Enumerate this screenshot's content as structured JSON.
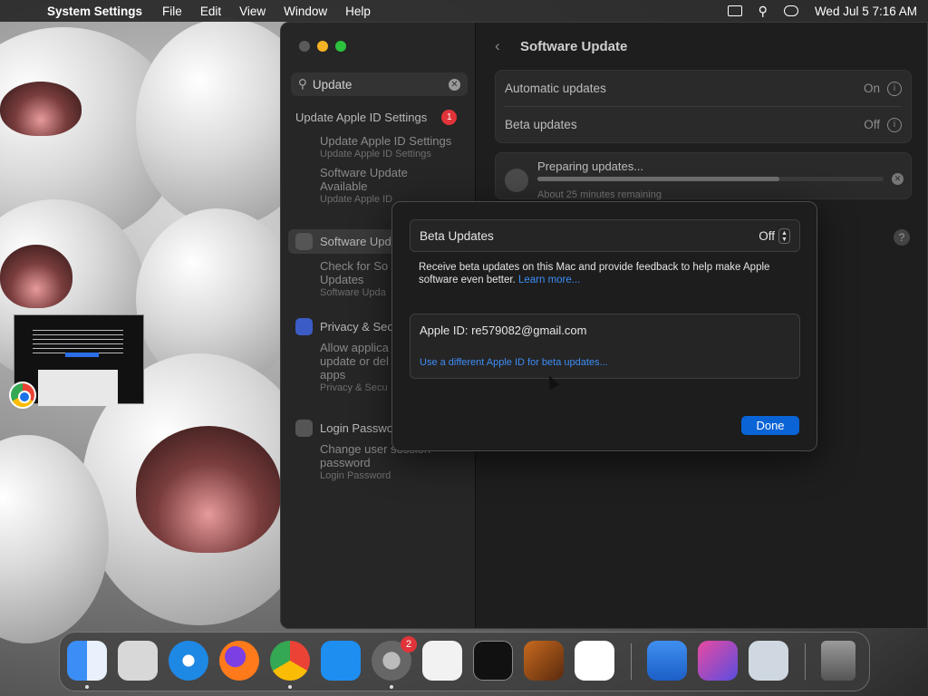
{
  "menubar": {
    "app_name": "System Settings",
    "items": [
      "File",
      "Edit",
      "View",
      "Window",
      "Help"
    ],
    "clock": "Wed Jul 5  7:16 AM"
  },
  "sidebar": {
    "search_value": "Update",
    "results": [
      {
        "title": "Update Apple ID Settings",
        "badge": "1",
        "subs": [
          {
            "title": "Update Apple ID Settings",
            "subtitle": "Update Apple ID Settings"
          },
          {
            "title": "Software Update Available",
            "subtitle": "Update Apple ID"
          }
        ]
      },
      {
        "title": "Software Upd",
        "subs": [
          {
            "title": "Check for So Updates",
            "subtitle": "Software Upda"
          }
        ]
      },
      {
        "title": "Privacy & Sec",
        "subs": [
          {
            "title": "Allow applica update or del apps",
            "subtitle": "Privacy & Secu"
          }
        ]
      },
      {
        "title": "Login Passwo",
        "subs": [
          {
            "title": "Change user session password",
            "subtitle": "Login Password"
          }
        ]
      }
    ]
  },
  "main": {
    "title": "Software Update",
    "automatic_updates": {
      "label": "Automatic updates",
      "value": "On"
    },
    "beta_updates": {
      "label": "Beta updates",
      "value": "Off"
    },
    "progress": {
      "label": "Preparing updates...",
      "remaining": "About 25 minutes remaining",
      "fraction": 0.7
    }
  },
  "sheet": {
    "beta_label": "Beta Updates",
    "beta_value": "Off",
    "description": "Receive beta updates on this Mac and provide feedback to help make Apple software even better.",
    "learn_more": "Learn more...",
    "apple_id_label": "Apple ID: re579082@gmail.com",
    "different_id_link": "Use a different Apple ID for beta updates...",
    "done_label": "Done"
  },
  "dock": {
    "system_settings_badge": "2"
  },
  "colors": {
    "accent": "#0a64d6",
    "link": "#3d8df5",
    "badge": "#e0343a"
  }
}
